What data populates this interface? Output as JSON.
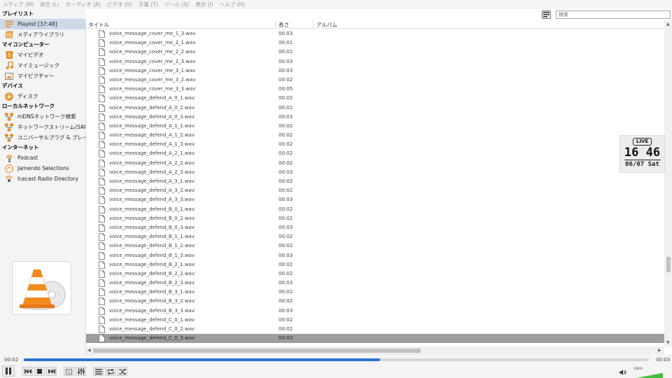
{
  "menu": [
    "メディア (M)",
    "再生 (L)",
    "オーディオ (A)",
    "ビデオ (V)",
    "字幕 (T)",
    "ツール (S)",
    "表示 (I)",
    "ヘルプ (H)"
  ],
  "sidebar": {
    "sections": [
      {
        "title": "プレイリスト",
        "items": [
          {
            "label": "Playlist [37:48]",
            "icon": "playlist-icon",
            "selected": true
          },
          {
            "label": "メディアライブラリ",
            "icon": "media-library-icon"
          }
        ]
      },
      {
        "title": "マイコンピューター",
        "items": [
          {
            "label": "マイビデオ",
            "icon": "video-icon"
          },
          {
            "label": "マイミュージック",
            "icon": "music-icon"
          },
          {
            "label": "マイピクチャー",
            "icon": "picture-icon"
          }
        ]
      },
      {
        "title": "デバイス",
        "items": [
          {
            "label": "ディスク",
            "icon": "disc-icon"
          }
        ]
      },
      {
        "title": "ローカルネットワーク",
        "items": [
          {
            "label": "mDNSネットワーク検索",
            "icon": "network-icon"
          },
          {
            "label": "ネットワークストリーム(SAP)",
            "icon": "network-icon"
          },
          {
            "label": "ユニバーサルプラグ & プレイ",
            "icon": "network-icon"
          }
        ]
      },
      {
        "title": "インターネット",
        "items": [
          {
            "label": "Podcast",
            "icon": "podcast-icon"
          },
          {
            "label": "Jamendo Selections",
            "icon": "jamendo-icon"
          },
          {
            "label": "Icecast Radio Directory",
            "icon": "icecast-icon"
          }
        ]
      }
    ]
  },
  "search": {
    "placeholder": "検索"
  },
  "playlist": {
    "columns": {
      "title": "タイトル",
      "length": "長さ",
      "album": "アルバム"
    },
    "rows": [
      {
        "title": "voice_message_cover_me_1_3.wav",
        "length": "00:03"
      },
      {
        "title": "voice_message_cover_me_2_1.wav",
        "length": "00:01"
      },
      {
        "title": "voice_message_cover_me_2_2.wav",
        "length": "00:02"
      },
      {
        "title": "voice_message_cover_me_2_3.wav",
        "length": "00:03"
      },
      {
        "title": "voice_message_cover_me_3_1.wav",
        "length": "00:03"
      },
      {
        "title": "voice_message_cover_me_3_2.wav",
        "length": "00:02"
      },
      {
        "title": "voice_message_cover_me_3_3.wav",
        "length": "00:05"
      },
      {
        "title": "voice_message_defend_A_0_1.wav",
        "length": "00:02"
      },
      {
        "title": "voice_message_defend_A_0_2.wav",
        "length": "00:02"
      },
      {
        "title": "voice_message_defend_A_0_3.wav",
        "length": "00:03"
      },
      {
        "title": "voice_message_defend_A_1_1.wav",
        "length": "00:02"
      },
      {
        "title": "voice_message_defend_A_1_2.wav",
        "length": "00:02"
      },
      {
        "title": "voice_message_defend_A_1_3.wav",
        "length": "00:02"
      },
      {
        "title": "voice_message_defend_A_2_1.wav",
        "length": "00:02"
      },
      {
        "title": "voice_message_defend_A_2_2.wav",
        "length": "00:02"
      },
      {
        "title": "voice_message_defend_A_2_3.wav",
        "length": "00:03"
      },
      {
        "title": "voice_message_defend_A_3_1.wav",
        "length": "00:02"
      },
      {
        "title": "voice_message_defend_A_3_2.wav",
        "length": "00:02"
      },
      {
        "title": "voice_message_defend_A_3_3.wav",
        "length": "00:03"
      },
      {
        "title": "voice_message_defend_B_0_1.wav",
        "length": "00:02"
      },
      {
        "title": "voice_message_defend_B_0_2.wav",
        "length": "00:02"
      },
      {
        "title": "voice_message_defend_B_0_3.wav",
        "length": "00:03"
      },
      {
        "title": "voice_message_defend_B_1_1.wav",
        "length": "00:02"
      },
      {
        "title": "voice_message_defend_B_1_2.wav",
        "length": "00:02"
      },
      {
        "title": "voice_message_defend_B_1_3.wav",
        "length": "00:03"
      },
      {
        "title": "voice_message_defend_B_2_1.wav",
        "length": "00:02"
      },
      {
        "title": "voice_message_defend_B_2_2.wav",
        "length": "00:02"
      },
      {
        "title": "voice_message_defend_B_2_3.wav",
        "length": "00:03"
      },
      {
        "title": "voice_message_defend_B_3_1.wav",
        "length": "00:02"
      },
      {
        "title": "voice_message_defend_B_3_2.wav",
        "length": "00:02"
      },
      {
        "title": "voice_message_defend_B_3_3.wav",
        "length": "00:03"
      },
      {
        "title": "voice_message_defend_C_0_1.wav",
        "length": "00:02"
      },
      {
        "title": "voice_message_defend_C_0_2.wav",
        "length": "00:02"
      },
      {
        "title": "voice_message_defend_C_0_3.wav",
        "length": "00:03",
        "selected": true
      }
    ]
  },
  "clock": {
    "badge": "LIVE",
    "time": "16 46",
    "date": "06/07 Sat"
  },
  "player": {
    "elapsed": "00:02",
    "total": "00:03",
    "progress": 0.57,
    "volume_label": "100%",
    "volume": 1.0
  },
  "colors": {
    "accent": "#2b74d4",
    "selected_row": "#9e9e9e",
    "sidebar_selected": "#cdd9e6",
    "vlc_orange": "#f08b1d",
    "volume_green": "#3fbf3f"
  }
}
